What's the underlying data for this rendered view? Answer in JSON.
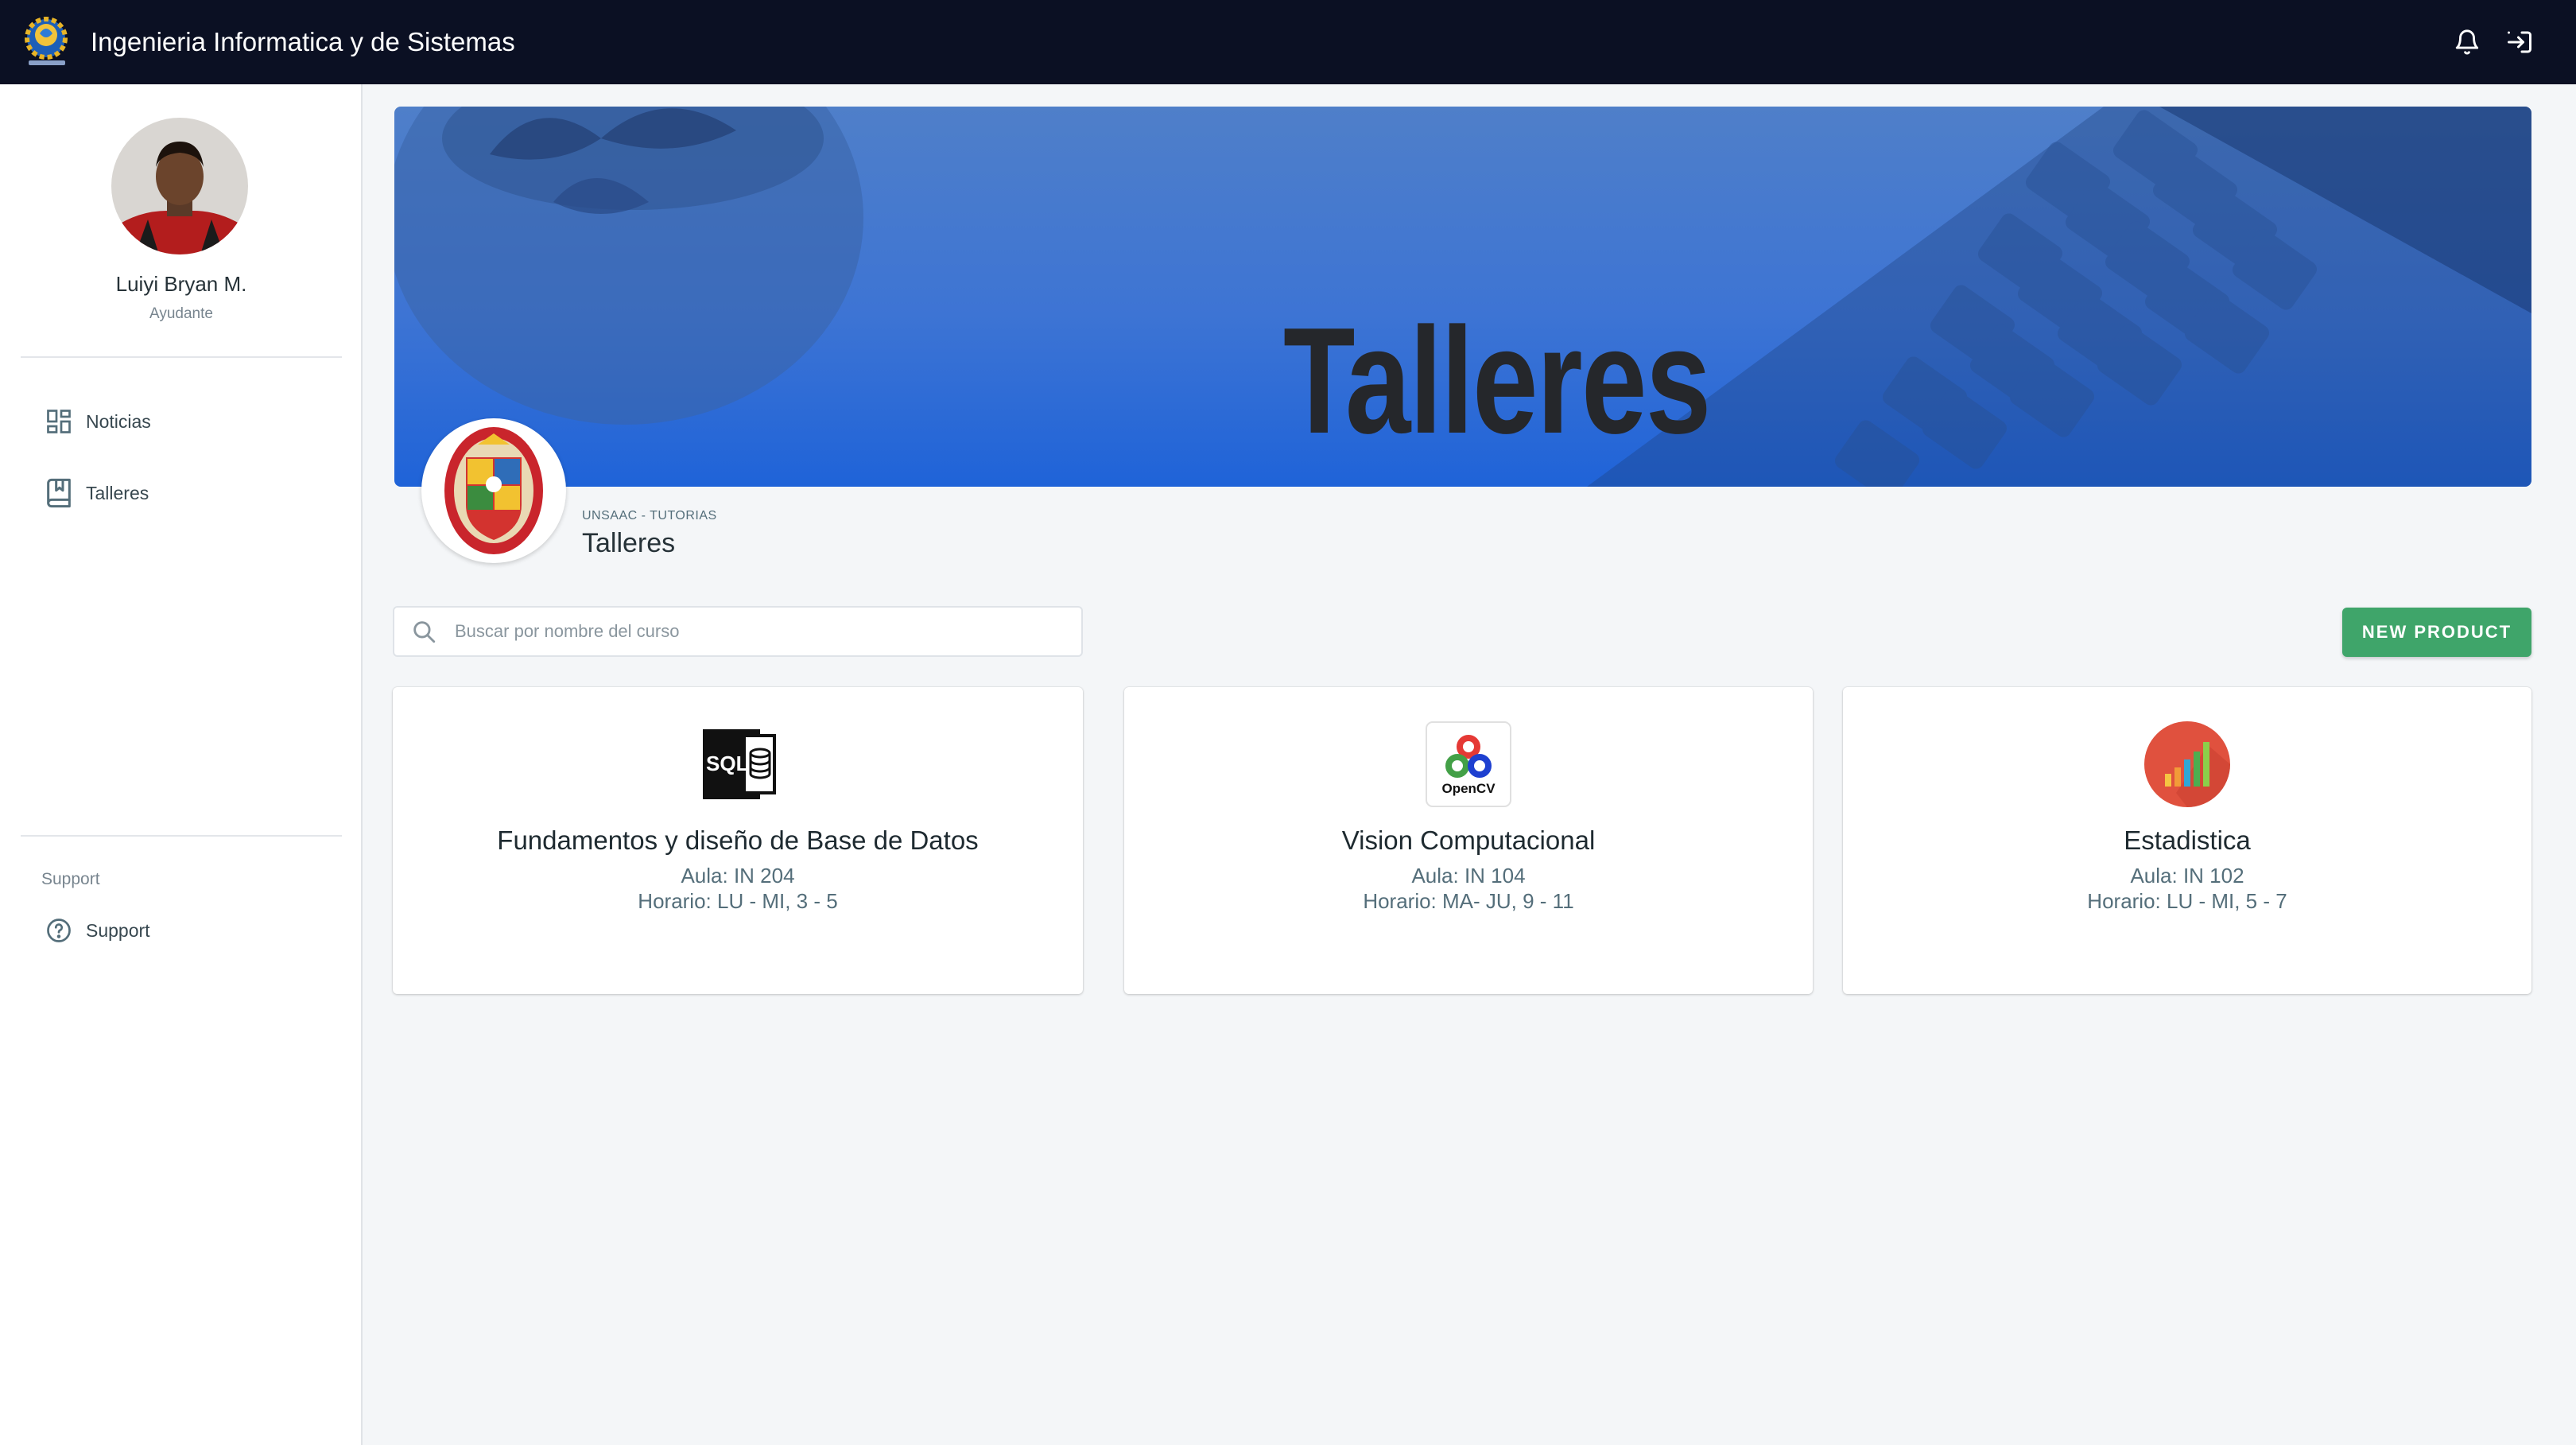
{
  "header": {
    "title": "Ingenieria Informatica y de Sistemas",
    "notifications_icon": "bell-icon",
    "logout_icon": "logout-icon"
  },
  "sidebar": {
    "user": {
      "name": "Luiyi Bryan M.",
      "role": "Ayudante"
    },
    "items": [
      {
        "label": "Noticias",
        "icon": "dashboard-icon"
      },
      {
        "label": "Talleres",
        "icon": "book-icon"
      }
    ],
    "support_heading": "Support",
    "support_item": {
      "label": "Support",
      "icon": "help-circle-icon"
    }
  },
  "banner": {
    "title": "Talleres"
  },
  "page": {
    "overline": "UNSAAC - TUTORIAS",
    "title": "Talleres"
  },
  "toolbar": {
    "search_placeholder": "Buscar por nombre del curso",
    "new_button_label": "NEW PRODUCT"
  },
  "courses": [
    {
      "title": "Fundamentos y diseño de Base de Datos",
      "room": "Aula: IN 204",
      "schedule": "Horario: LU - MI, 3 - 5",
      "icon": "sql-database-icon"
    },
    {
      "title": "Vision Computacional",
      "room": "Aula: IN 104",
      "schedule": "Horario: MA- JU, 9 - 11",
      "icon": "opencv-logo",
      "logo_text": "OpenCV"
    },
    {
      "title": "Estadistica",
      "room": "Aula: IN 102",
      "schedule": "Horario: LU - MI, 5 - 7",
      "icon": "bar-chart-icon"
    }
  ],
  "colors": {
    "topbar": "#0b1023",
    "primary_button": "#3fa56a",
    "banner_blue": "#1f63d8"
  }
}
